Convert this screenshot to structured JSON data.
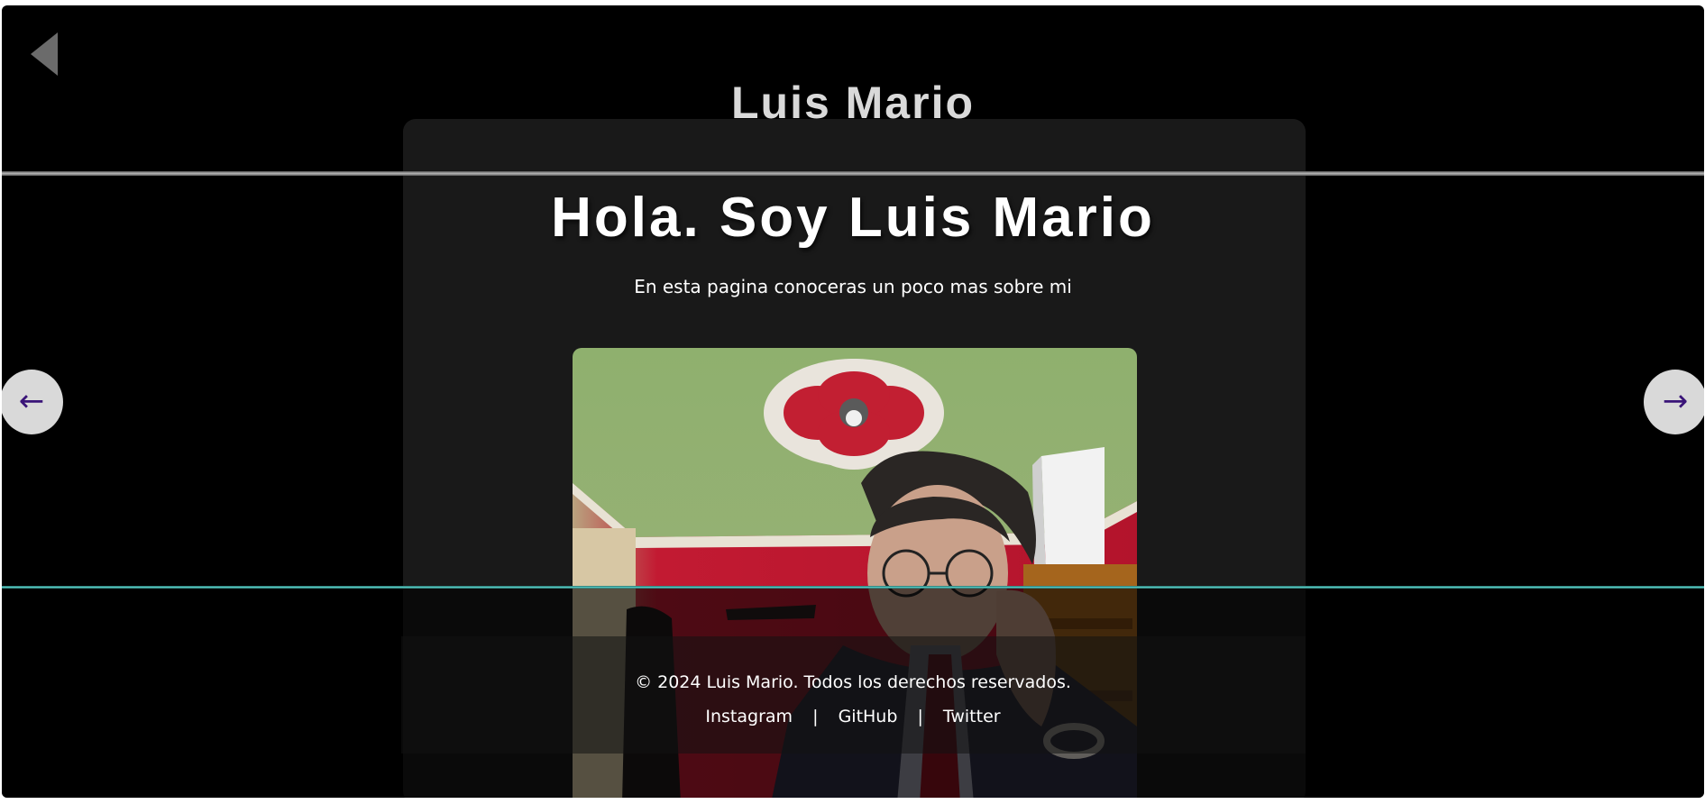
{
  "header": {
    "back_icon": "back-triangle-icon",
    "title": "Luis Mario"
  },
  "hero": {
    "title": "Hola. Soy Luis Mario",
    "subtitle": "En esta pagina conoceras un poco mas sobre mi",
    "photo_icon": "portrait-photo"
  },
  "carousel": {
    "prev_label": "←",
    "next_label": "→"
  },
  "footer": {
    "copyright": "© 2024 Luis Mario. Todos los derechos reservados.",
    "links": [
      {
        "label": "Instagram"
      },
      {
        "label": "GitHub"
      },
      {
        "label": "Twitter"
      }
    ],
    "separator": "|"
  },
  "colors": {
    "background": "#000000",
    "card": "#191919",
    "title_text": "#d9d9d9",
    "arrow_bg": "#d9d9d9",
    "arrow_fg": "#3a1478",
    "footer_accent": "#5fd8d0"
  }
}
